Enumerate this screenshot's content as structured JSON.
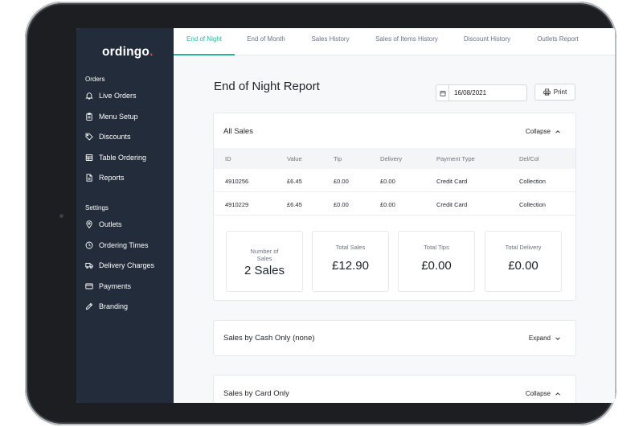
{
  "app": {
    "logo_text": "ordingo",
    "logo_dot": "."
  },
  "sidebar": {
    "orders_heading": "Orders",
    "orders_items": [
      {
        "label": "Live Orders",
        "icon": "bell-icon"
      },
      {
        "label": "Menu Setup",
        "icon": "clipboard-icon"
      },
      {
        "label": "Discounts",
        "icon": "tag-icon"
      },
      {
        "label": "Table Ordering",
        "icon": "table-icon"
      },
      {
        "label": "Reports",
        "icon": "document-icon"
      }
    ],
    "settings_heading": "Settings",
    "settings_items": [
      {
        "label": "Outlets",
        "icon": "location-pin-icon"
      },
      {
        "label": "Ordering Times",
        "icon": "clock-icon"
      },
      {
        "label": "Delivery Charges",
        "icon": "truck-icon"
      },
      {
        "label": "Payments",
        "icon": "credit-card-icon"
      },
      {
        "label": "Branding",
        "icon": "pencil-icon"
      }
    ]
  },
  "tabs": [
    "End of Night",
    "End of Month",
    "Sales History",
    "Sales of Items History",
    "Discount History",
    "Outlets Report"
  ],
  "active_tab": "End of Night",
  "page": {
    "title": "End of Night Report",
    "date_value": "16/08/2021",
    "print_label": "Print"
  },
  "all_sales": {
    "title": "All Sales",
    "toggle": "Collapse",
    "columns": [
      "ID",
      "Value",
      "Tip",
      "Delivery",
      "Payment Type",
      "Del/Col"
    ],
    "rows": [
      [
        "4910256",
        "£6.45",
        "£0.00",
        "£0.00",
        "Credit Card",
        "Collection"
      ],
      [
        "4910229",
        "£6.45",
        "£0.00",
        "£0.00",
        "Credit Card",
        "Collection"
      ]
    ],
    "stats": [
      {
        "label": "Number of Sales",
        "value": "2 Sales"
      },
      {
        "label": "Total Sales",
        "value": "£12.90"
      },
      {
        "label": "Total Tips",
        "value": "£0.00"
      },
      {
        "label": "Total Delivery",
        "value": "£0.00"
      }
    ]
  },
  "cash_section": {
    "title": "Sales by Cash Only (none)",
    "toggle": "Expand"
  },
  "card_section": {
    "title": "Sales by Card Only",
    "toggle": "Collapse"
  },
  "colors": {
    "sidebar_bg": "#232c3a",
    "accent": "#2bb3a0",
    "logo_dot": "#e0405a"
  }
}
